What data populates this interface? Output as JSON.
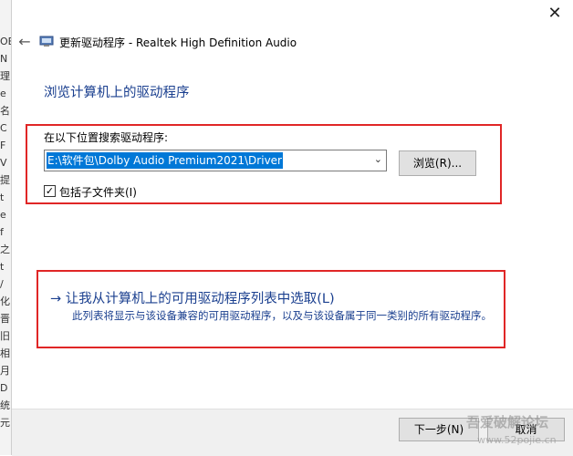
{
  "background": {
    "left_glyphs": [
      "OE",
      "N",
      "理",
      "e",
      "名",
      "C",
      "F",
      "V",
      "提",
      "t",
      "e",
      "f",
      "之",
      "t",
      "/",
      "化",
      "晋",
      "旧",
      "相",
      "月",
      "D",
      "统",
      "元"
    ]
  },
  "dialog": {
    "title": "更新驱动程序 - Realtek High Definition Audio",
    "heading": "浏览计算机上的驱动程序",
    "search_label": "在以下位置搜索驱动程序:",
    "path_value": "E:\\软件包\\Dolby Audio Premium2021\\Driver",
    "browse_label": "浏览(R)...",
    "include_subfolders_label": "包括子文件夹(I)",
    "include_subfolders_checked": true,
    "option_title": "让我从计算机上的可用驱动程序列表中选取(L)",
    "option_description": "此列表将显示与该设备兼容的可用驱动程序，以及与该设备属于同一类别的所有驱动程序。",
    "next_label": "下一步(N)",
    "cancel_label": "取消"
  },
  "watermark": {
    "title": "吾爱破解论坛",
    "url": "www.52pojie.cn"
  },
  "colors": {
    "heading_blue": "#1a3f8f",
    "highlight_red": "#e02626",
    "selection_blue": "#0078d7"
  },
  "icons": {
    "close": "close-icon",
    "back": "back-arrow-icon",
    "combo": "chevron-down-icon",
    "option": "arrow-right-icon"
  }
}
